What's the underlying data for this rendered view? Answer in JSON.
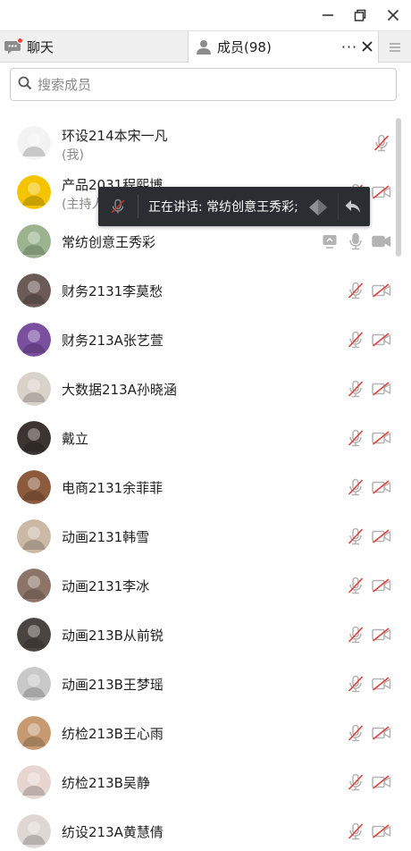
{
  "window": {
    "minimize_icon": "minimize-icon",
    "restore_icon": "restore-icon",
    "close_icon": "close-icon"
  },
  "tabs": {
    "chat": {
      "label": "聊天",
      "icon": "chat-bubble-icon",
      "has_unread_dot": true
    },
    "members": {
      "label": "成员(98)",
      "icon": "person-icon"
    },
    "more_label": "···",
    "close_icon": "close-icon",
    "menu_icon": "hamburger-icon"
  },
  "search": {
    "placeholder": "搜索成员",
    "value": ""
  },
  "toast": {
    "text": "正在讲话: 常纺创意王秀彩;",
    "icons": [
      "mic-muted-icon",
      "collapse-back-icon"
    ]
  },
  "members": [
    {
      "name": "环设214本宋一凡",
      "sub": "(我)",
      "mic": "muted",
      "cam": "none"
    },
    {
      "name": "产品2031程熙博",
      "sub": "(主持人)",
      "mic": "muted",
      "cam": "off"
    },
    {
      "name": "常纺创意王秀彩",
      "sub": "",
      "mic": "on",
      "cam": "on",
      "share": true
    },
    {
      "name": "财务2131李莫愁",
      "sub": "",
      "mic": "muted",
      "cam": "off"
    },
    {
      "name": "财务213A张艺萱",
      "sub": "",
      "mic": "muted",
      "cam": "off"
    },
    {
      "name": "大数据213A孙晓涵",
      "sub": "",
      "mic": "muted",
      "cam": "off"
    },
    {
      "name": "戴立",
      "sub": "",
      "mic": "muted",
      "cam": "off"
    },
    {
      "name": "电商2131余菲菲",
      "sub": "",
      "mic": "muted",
      "cam": "off"
    },
    {
      "name": "动画2131韩雪",
      "sub": "",
      "mic": "muted",
      "cam": "off"
    },
    {
      "name": "动画2131李冰",
      "sub": "",
      "mic": "muted",
      "cam": "off"
    },
    {
      "name": "动画213B从前锐",
      "sub": "",
      "mic": "muted",
      "cam": "off"
    },
    {
      "name": "动画213B王梦瑶",
      "sub": "",
      "mic": "muted",
      "cam": "off"
    },
    {
      "name": "纺检213B王心雨",
      "sub": "",
      "mic": "muted",
      "cam": "off"
    },
    {
      "name": "纺检213B吴静",
      "sub": "",
      "mic": "muted",
      "cam": "off"
    },
    {
      "name": "纺设213A黄慧倩",
      "sub": "",
      "mic": "muted",
      "cam": "off"
    }
  ],
  "colors": {
    "muted_red": "#e0413a",
    "icon_gray": "#b3b3b3",
    "toast_bg": "#2a2d31",
    "unread_dot": "#f04134"
  },
  "avatar_palette": [
    "#f3f3f3",
    "#f5c400",
    "#9bb48f",
    "#6b5a55",
    "#7a4fa0",
    "#d9d2c8",
    "#3b3430",
    "#8c5a3c",
    "#cbb9a6",
    "#8d7468",
    "#4a4540",
    "#c9c9c9",
    "#c79a72",
    "#e6d6cf",
    "#ded7d3"
  ]
}
